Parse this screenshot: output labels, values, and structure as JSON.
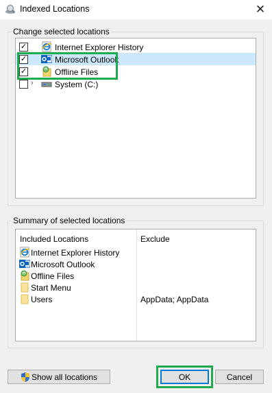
{
  "window": {
    "title": "Indexed Locations",
    "close_glyph": "✕"
  },
  "change_group": {
    "label": "Change selected locations",
    "items": [
      {
        "label": "Internet Explorer History",
        "checked": true,
        "icon": "ie-icon"
      },
      {
        "label": "Microsoft Outlook",
        "checked": true,
        "icon": "outlook-icon",
        "selected": true
      },
      {
        "label": "Offline Files",
        "checked": true,
        "icon": "offline-files-icon"
      },
      {
        "label": "System (C:)",
        "checked": false,
        "icon": "drive-icon",
        "expandable": true
      }
    ],
    "check_glyph": "✓",
    "expander_glyph": "›"
  },
  "summary_group": {
    "label": "Summary of selected locations",
    "columns": {
      "included": "Included Locations",
      "exclude": "Exclude"
    },
    "rows": [
      {
        "included": "Internet Explorer History",
        "exclude": "",
        "icon": "ie-icon"
      },
      {
        "included": "Microsoft Outlook",
        "exclude": "",
        "icon": "outlook-icon"
      },
      {
        "included": "Offline Files",
        "exclude": "",
        "icon": "offline-files-icon"
      },
      {
        "included": "Start Menu",
        "exclude": "",
        "icon": "folder-icon"
      },
      {
        "included": "Users",
        "exclude": "AppData; AppData",
        "icon": "folder-icon"
      }
    ]
  },
  "buttons": {
    "show_all": "Show all locations",
    "ok": "OK",
    "cancel": "Cancel"
  },
  "colors": {
    "highlight": "#1faa4e",
    "selection": "#cce8ff",
    "default_button_border": "#0078d7"
  }
}
